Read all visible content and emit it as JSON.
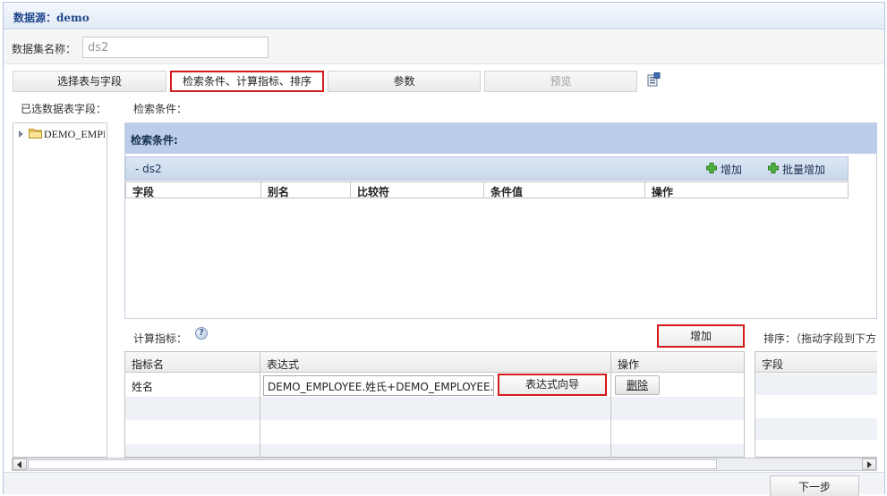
{
  "window": {
    "title": "数据源：demo"
  },
  "dataset": {
    "label": "数据集名称：",
    "value": "ds2"
  },
  "tabs": [
    {
      "label": "选择表与字段"
    },
    {
      "label": "检索条件、计算指标、排序"
    },
    {
      "label": "参数"
    },
    {
      "label": "预览"
    }
  ],
  "left": {
    "label": "已选数据表字段：",
    "tree": [
      {
        "label": "DEMO_EMPLOYEE",
        "icon": "folder-icon"
      }
    ]
  },
  "search": {
    "label": "检索条件：",
    "panel_title": "检索条件:",
    "group": "- ds2",
    "add_label": "增加",
    "batch_add_label": "批量增加",
    "columns": [
      "字段",
      "别名",
      "比较符",
      "条件值",
      "操作"
    ]
  },
  "calc": {
    "label": "计算指标：",
    "help_glyph": "?",
    "add_label": "增加",
    "columns": [
      "指标名",
      "表达式",
      "操作"
    ],
    "rows": [
      {
        "name": "姓名",
        "expression": "DEMO_EMPLOYEE.姓氏+DEMO_EMPLOYEE.名字",
        "wizard_label": "表达式向导",
        "delete_label": "删除"
      }
    ]
  },
  "sort": {
    "label": "排序：（拖动字段到下方",
    "columns": [
      "字段"
    ]
  },
  "footer": {
    "next_label": "下一步"
  },
  "colors": {
    "accent_red": "#d41b1b",
    "header_blue": "#bccde9",
    "title_blue": "#22488c"
  }
}
